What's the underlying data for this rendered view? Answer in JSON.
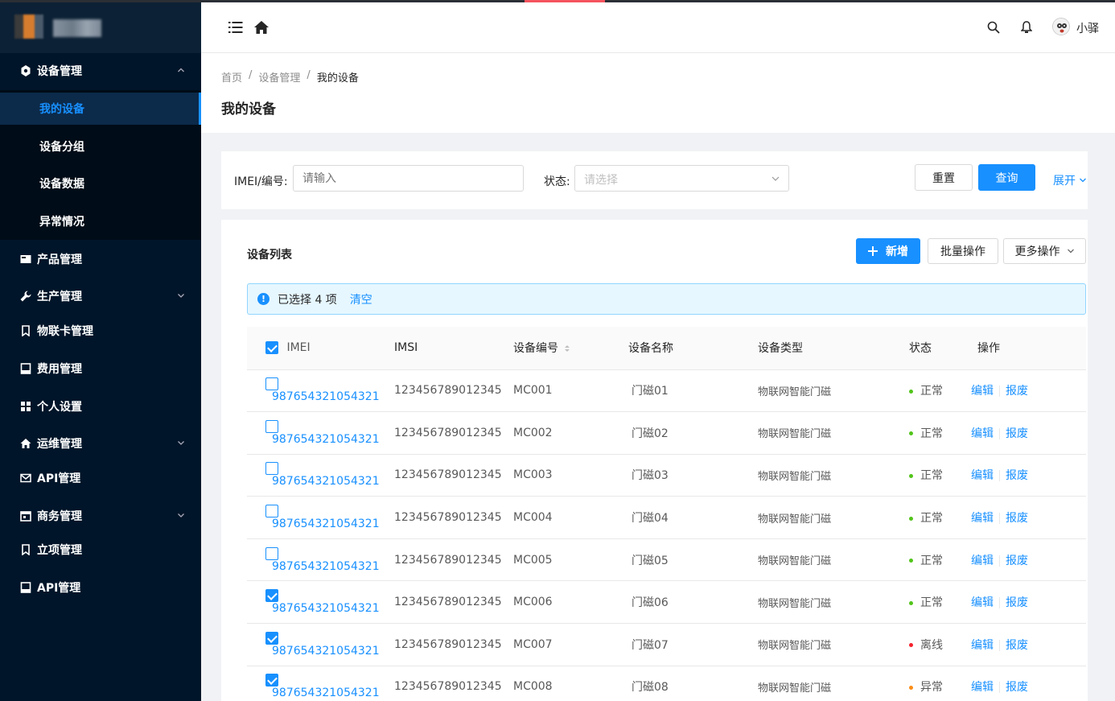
{
  "sidebar": {
    "items": [
      {
        "label": "设备管理",
        "icon": "settings-icon",
        "expanded": true
      },
      {
        "label": "产品管理",
        "icon": "card-icon"
      },
      {
        "label": "生产管理",
        "icon": "wrench-icon",
        "has_children": true
      },
      {
        "label": "物联卡管理",
        "icon": "bookmark-icon"
      },
      {
        "label": "费用管理",
        "icon": "book-icon"
      },
      {
        "label": "个人设置",
        "icon": "grid-icon"
      },
      {
        "label": "运维管理",
        "icon": "home-icon",
        "has_children": true
      },
      {
        "label": "API管理",
        "icon": "mail-icon"
      },
      {
        "label": "商务管理",
        "icon": "calendar-icon",
        "has_children": true
      },
      {
        "label": "立项管理",
        "icon": "bookmark-icon"
      },
      {
        "label": "API管理",
        "icon": "book-icon"
      }
    ],
    "subitems": [
      "我的设备",
      "设备分组",
      "设备数据",
      "异常情况"
    ],
    "active_subitem": "我的设备"
  },
  "header": {
    "username": "小驿"
  },
  "breadcrumb": [
    "首页",
    "设备管理",
    "我的设备"
  ],
  "page_title": "我的设备",
  "filter": {
    "imei_label": "IMEI/编号:",
    "imei_placeholder": "请输入",
    "status_label": "状态:",
    "status_placeholder": "请选择",
    "reset_label": "重置",
    "query_label": "查询",
    "expand_label": "展开"
  },
  "list": {
    "title": "设备列表",
    "add_label": "新增",
    "batch_label": "批量操作",
    "more_label": "更多操作",
    "alert_prefix": "已选择 4 项",
    "alert_clear": "清空",
    "columns": [
      "IMEI",
      "IMSI",
      "设备编号",
      "设备名称",
      "设备类型",
      "状态",
      "操作"
    ],
    "rows": [
      {
        "checked": false,
        "imei": "987654321054321",
        "imsi": "123456789012345",
        "code": "MC001",
        "name": "门磁01",
        "type": "物联网智能门磁",
        "status": "正常",
        "status_color": "#52c41a"
      },
      {
        "checked": false,
        "imei": "987654321054321",
        "imsi": "123456789012345",
        "code": "MC002",
        "name": "门磁02",
        "type": "物联网智能门磁",
        "status": "正常",
        "status_color": "#52c41a"
      },
      {
        "checked": false,
        "imei": "987654321054321",
        "imsi": "123456789012345",
        "code": "MC003",
        "name": "门磁03",
        "type": "物联网智能门磁",
        "status": "正常",
        "status_color": "#52c41a"
      },
      {
        "checked": false,
        "imei": "987654321054321",
        "imsi": "123456789012345",
        "code": "MC004",
        "name": "门磁04",
        "type": "物联网智能门磁",
        "status": "正常",
        "status_color": "#52c41a"
      },
      {
        "checked": false,
        "imei": "987654321054321",
        "imsi": "123456789012345",
        "code": "MC005",
        "name": "门磁05",
        "type": "物联网智能门磁",
        "status": "正常",
        "status_color": "#52c41a"
      },
      {
        "checked": true,
        "imei": "987654321054321",
        "imsi": "123456789012345",
        "code": "MC006",
        "name": "门磁06",
        "type": "物联网智能门磁",
        "status": "正常",
        "status_color": "#52c41a"
      },
      {
        "checked": true,
        "imei": "987654321054321",
        "imsi": "123456789012345",
        "code": "MC007",
        "name": "门磁07",
        "type": "物联网智能门磁",
        "status": "离线",
        "status_color": "#f5222d"
      },
      {
        "checked": true,
        "imei": "987654321054321",
        "imsi": "123456789012345",
        "code": "MC008",
        "name": "门磁08",
        "type": "物联网智能门磁",
        "status": "异常",
        "status_color": "#fa8c16"
      }
    ],
    "row_actions": [
      "编辑",
      "报废"
    ]
  },
  "colors": {
    "primary": "#1890ff",
    "sidebar_bg": "#001529",
    "success": "#52c41a",
    "error": "#f5222d",
    "warning": "#fa8c16"
  }
}
